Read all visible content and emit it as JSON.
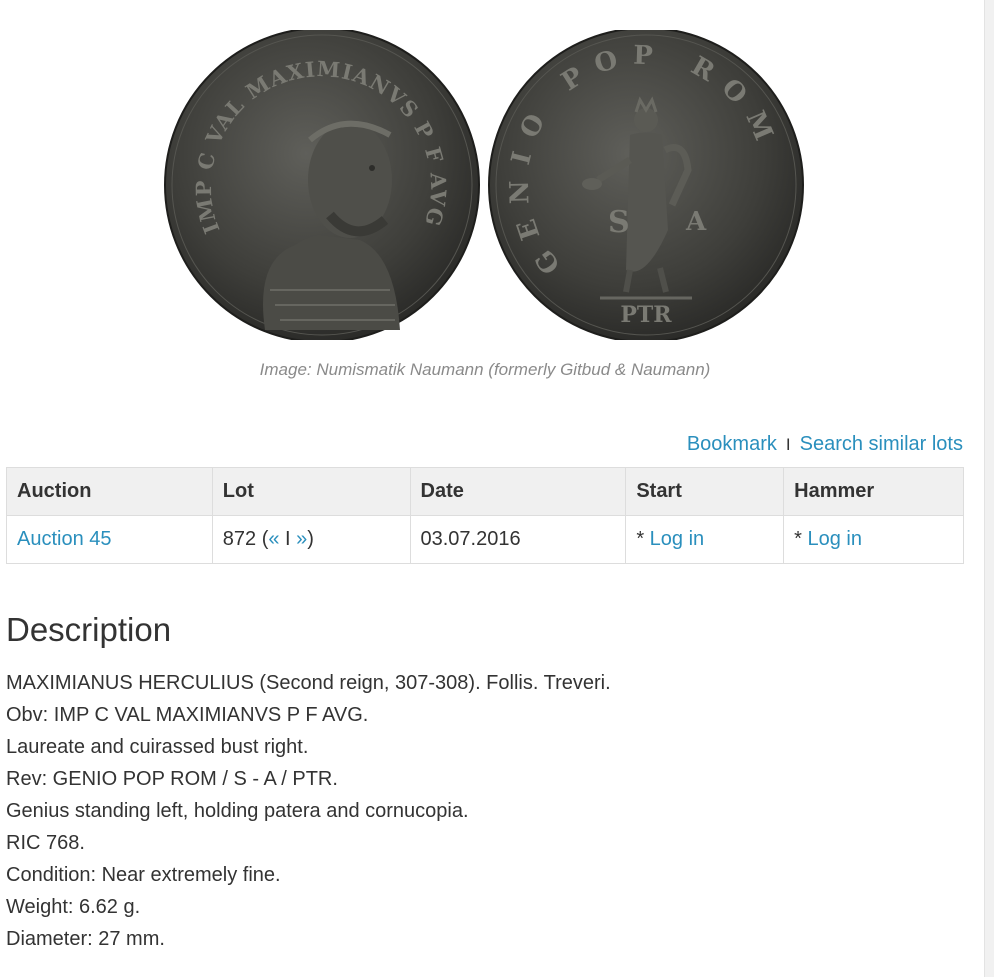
{
  "image": {
    "credit": "Image: Numismatik Naumann (formerly Gitbud & Naumann)",
    "obverse_legend": "IMP C VAL MAXIMIANVS P F AVG",
    "reverse_legend": "GENIO POP ROM",
    "reverse_field_left": "S",
    "reverse_field_right": "A",
    "reverse_exergue": "PTR"
  },
  "actions": {
    "bookmark_label": "Bookmark",
    "separator": "I",
    "search_similar_label": "Search similar lots"
  },
  "table": {
    "headers": {
      "auction": "Auction",
      "lot": "Lot",
      "date": "Date",
      "start": "Start",
      "hammer": "Hammer"
    },
    "row": {
      "auction": "Auction 45",
      "lot_number": "872",
      "lot_open": " (",
      "prev": "«",
      "divider": " I ",
      "next": "»",
      "lot_close": ")",
      "date": "03.07.2016",
      "start_prefix": "* ",
      "start_link": "Log in",
      "hammer_prefix": "* ",
      "hammer_link": "Log in"
    }
  },
  "description": {
    "heading": "Description",
    "lines": [
      "MAXIMIANUS HERCULIUS (Second reign, 307-308). Follis. Treveri.",
      "Obv: IMP C VAL MAXIMIANVS P F AVG.",
      "Laureate and cuirassed bust right.",
      "Rev: GENIO POP ROM / S - A / PTR.",
      "Genius standing left, holding patera and cornucopia.",
      "RIC 768.",
      "Condition: Near extremely fine.",
      "Weight: 6.62 g.",
      "Diameter: 27 mm."
    ]
  },
  "colors": {
    "link": "#2a8fbd",
    "text": "#333333",
    "header_bg": "#f0f0f0",
    "credit": "#8a8a8a"
  }
}
